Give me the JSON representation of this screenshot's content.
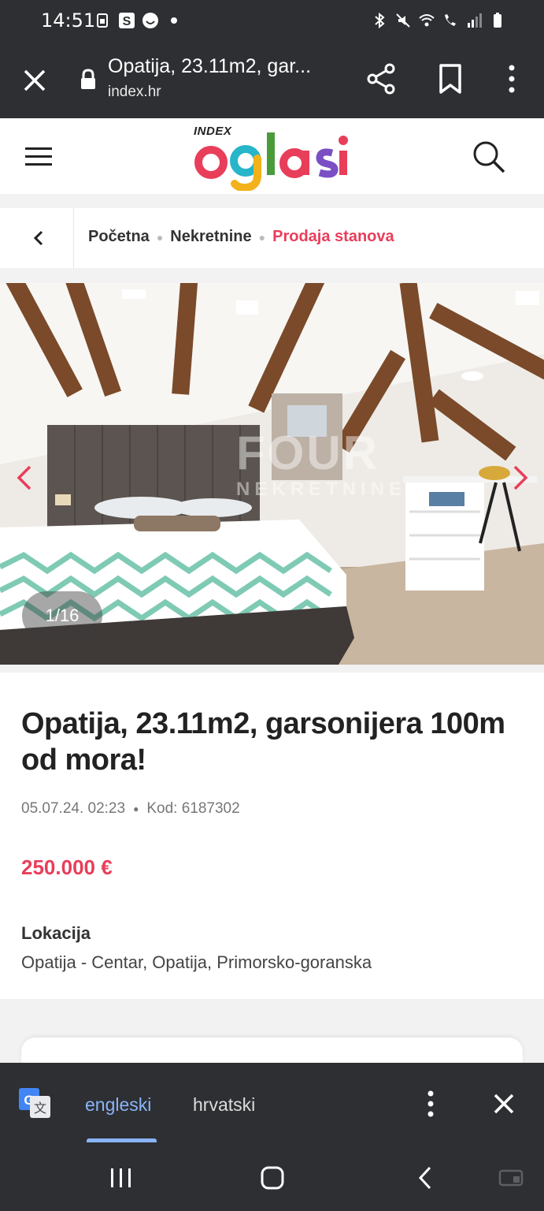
{
  "status_bar": {
    "time": "14:51",
    "icons": [
      "sim-icon",
      "samsung-s-icon",
      "smiley-icon",
      "dot-icon",
      "bluetooth-icon",
      "mute-icon",
      "wifi-icon",
      "wifi-call-icon",
      "signal-icon",
      "battery-icon"
    ]
  },
  "browser": {
    "tab_title": "Opatija, 23.11m2, gar...",
    "url": "index.hr"
  },
  "site": {
    "logo_small": "INDEX",
    "logo_word": "oglasi"
  },
  "breadcrumb": {
    "items": [
      "Početna",
      "Nekretnine"
    ],
    "current": "Prodaja stanova"
  },
  "gallery": {
    "counter": "1/16",
    "watermark_big": "FOUR",
    "watermark_small": "NEKRETNINE"
  },
  "listing": {
    "title": "Opatija, 23.11m2, garsonijera 100m od mora!",
    "date": "05.07.24. 02:23",
    "code": "Kod: 6187302",
    "price": "250.000 €",
    "location_label": "Lokacija",
    "location_value": "Opatija - Centar, Opatija, Primorsko-goranska"
  },
  "translate": {
    "lang_from": "engleski",
    "lang_to": "hrvatski"
  },
  "colors": {
    "accent": "#e83e5a",
    "dark_bar": "#2d2f33",
    "translate_blue": "#8ab4f8"
  }
}
